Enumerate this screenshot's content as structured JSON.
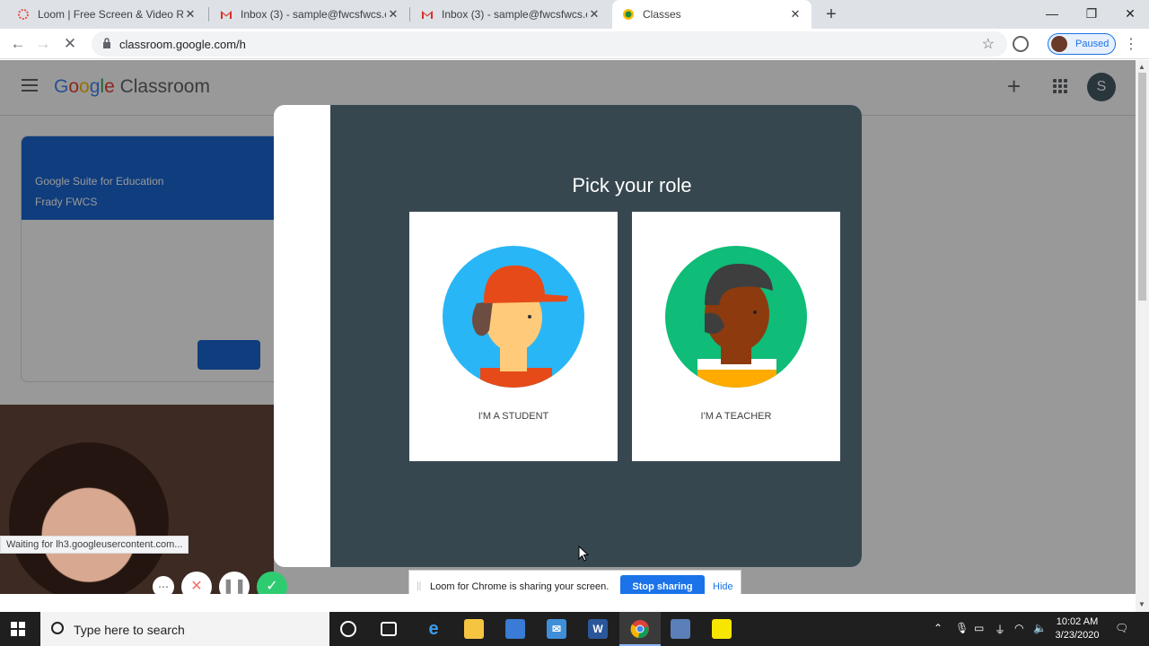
{
  "browser": {
    "tabs": [
      {
        "title": "Loom | Free Screen & Video Rec",
        "icon": "loom-icon"
      },
      {
        "title": "Inbox (3) - sample@fwcsfwcs.org",
        "icon": "gmail-icon"
      },
      {
        "title": "Inbox (3) - sample@fwcsfwcs.org",
        "icon": "gmail-icon"
      },
      {
        "title": "Classes",
        "icon": "classroom-icon"
      }
    ],
    "url": "classroom.google.com/h",
    "profile_label": "Paused"
  },
  "app": {
    "brand_parts": [
      "G",
      "o",
      "o",
      "g",
      "l",
      "e",
      " Classroom"
    ],
    "avatar_letter": "S"
  },
  "class_card": {
    "name": "Google Suite for Education",
    "section": "Frady FWCS"
  },
  "modal": {
    "title": "Pick your role",
    "roles": [
      {
        "label": "I'M A STUDENT"
      },
      {
        "label": "I'M A TEACHER"
      }
    ]
  },
  "loom": {
    "share_message": "Loom for Chrome is sharing your screen.",
    "stop_label": "Stop sharing",
    "hide_label": "Hide"
  },
  "status_text": "Waiting for lh3.googleusercontent.com...",
  "taskbar": {
    "search_placeholder": "Type here to search",
    "time": "10:02 AM",
    "date": "3/23/2020"
  },
  "colors": {
    "modal_dark": "#37474f",
    "accent_blue": "#1a73e8",
    "class_banner": "#1967d2"
  }
}
